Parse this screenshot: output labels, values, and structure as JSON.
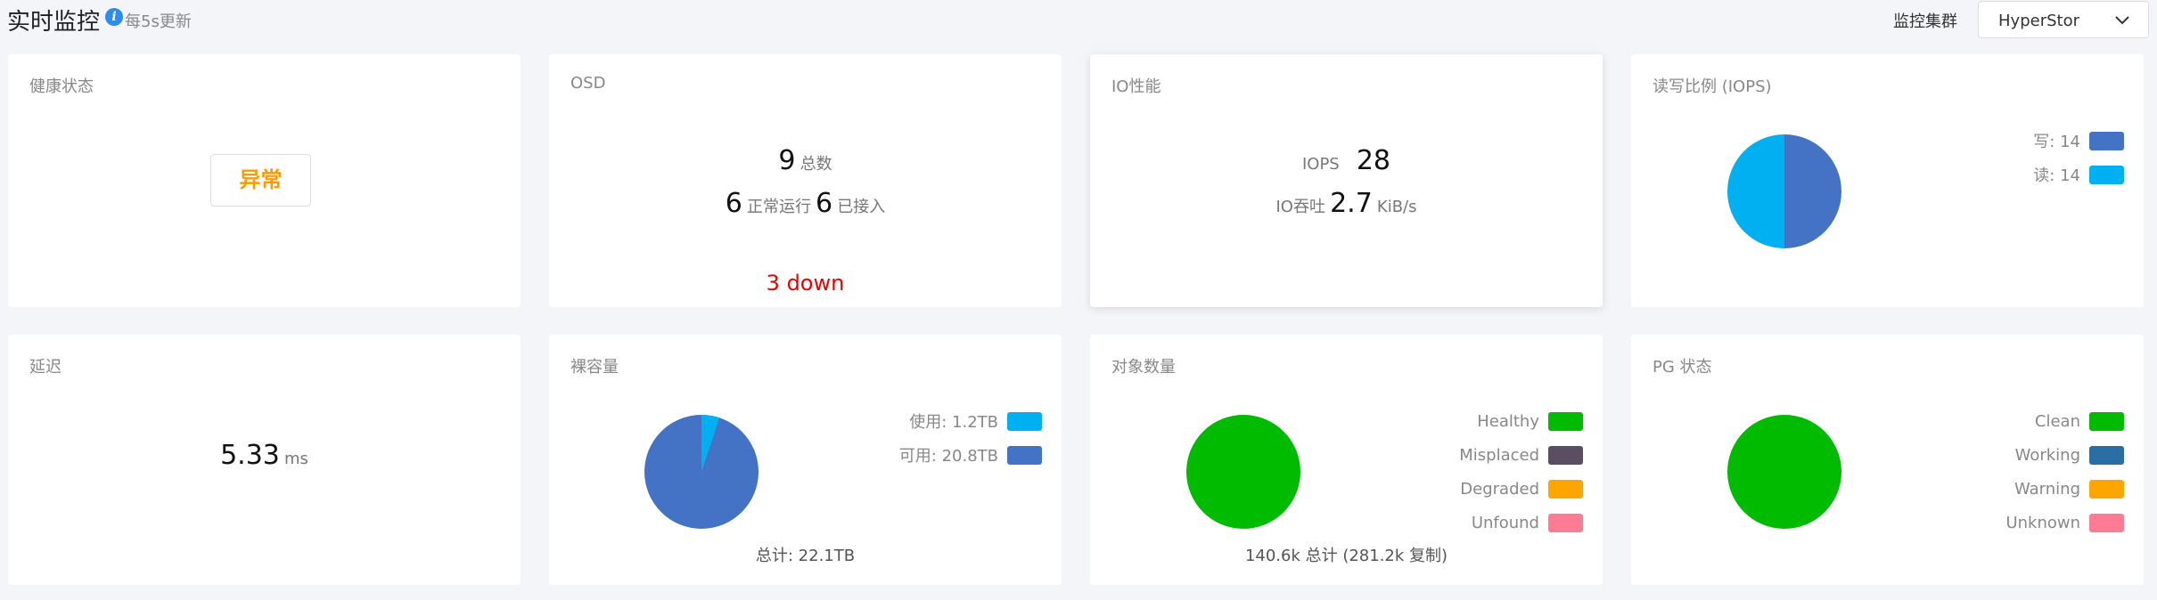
{
  "header": {
    "title": "实时监控",
    "refresh_note": "每5s更新",
    "info_icon": "info-icon",
    "cluster_label": "监控集群",
    "cluster_value": "HyperStor"
  },
  "health": {
    "title": "健康状态",
    "status": "异常",
    "status_color": "#ff9900"
  },
  "osd": {
    "title": "OSD",
    "total": "9",
    "total_label": "总数",
    "running": "6",
    "running_label": "正常运行",
    "connected": "6",
    "connected_label": "已接入",
    "down_text": "3 down"
  },
  "io": {
    "title": "IO性能",
    "iops_label": "IOPS",
    "iops_value": "28",
    "throughput_label": "IO吞吐",
    "throughput_value": "2.7",
    "throughput_unit": "KiB/s"
  },
  "rw_ratio": {
    "title": "读写比例 (IOPS)",
    "legend": [
      {
        "label": "写: 14",
        "color": "#4472c4",
        "value": 14
      },
      {
        "label": "读: 14",
        "color": "#00b0f0",
        "value": 14
      }
    ]
  },
  "latency": {
    "title": "延迟",
    "value": "5.33",
    "unit": "ms"
  },
  "raw_capacity": {
    "title": "裸容量",
    "legend": [
      {
        "label": "使用: 1.2TB",
        "color": "#00b0f0",
        "value": 1.2
      },
      {
        "label": "可用: 20.8TB",
        "color": "#4472c4",
        "value": 20.8
      }
    ],
    "total_text": "总计: 22.1TB"
  },
  "objects": {
    "title": "对象数量",
    "legend": [
      {
        "label": "Healthy",
        "color": "#00bb00",
        "value": 1
      },
      {
        "label": "Misplaced",
        "color": "#5a4e63",
        "value": 0
      },
      {
        "label": "Degraded",
        "color": "#ffa500",
        "value": 0
      },
      {
        "label": "Unfound",
        "color": "#fd7c93",
        "value": 0
      }
    ],
    "total_text": "140.6k 总计 (281.2k 复制)"
  },
  "pg": {
    "title": "PG 状态",
    "legend": [
      {
        "label": "Clean",
        "color": "#00bb00",
        "value": 1
      },
      {
        "label": "Working",
        "color": "#2a6ea6",
        "value": 0
      },
      {
        "label": "Warning",
        "color": "#ffa500",
        "value": 0
      },
      {
        "label": "Unknown",
        "color": "#fd7c93",
        "value": 0
      }
    ]
  }
}
